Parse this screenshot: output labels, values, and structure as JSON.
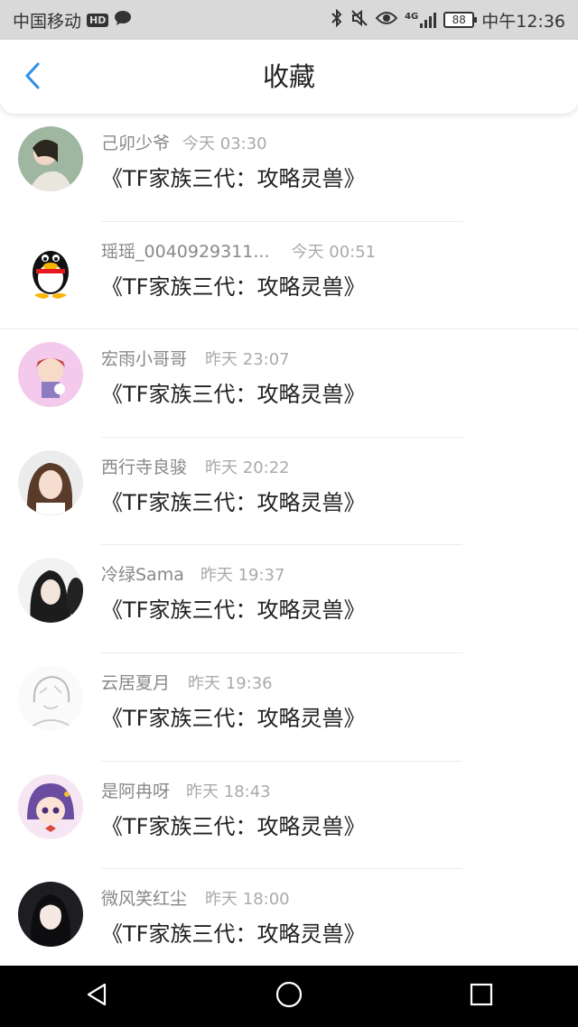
{
  "status_bar": {
    "carrier": "中国移动",
    "hd": "HD",
    "network": "4G",
    "battery": "88",
    "time": "中午12:36"
  },
  "header": {
    "title": "收藏"
  },
  "items": [
    {
      "user": "己卯少爷",
      "time": "今天 03:30",
      "title": "《TF家族三代：攻略灵兽》"
    },
    {
      "user": "瑶瑶_0040929311...",
      "time": "今天 00:51",
      "title": "《TF家族三代：攻略灵兽》"
    },
    {
      "user": "宏雨小哥哥",
      "time": "昨天 23:07",
      "title": "《TF家族三代：攻略灵兽》"
    },
    {
      "user": "西行寺良骏",
      "time": "昨天 20:22",
      "title": "《TF家族三代：攻略灵兽》"
    },
    {
      "user": "冷绿Sama",
      "time": "昨天 19:37",
      "title": "《TF家族三代：攻略灵兽》"
    },
    {
      "user": "云居夏月",
      "time": "昨天 19:36",
      "title": "《TF家族三代：攻略灵兽》"
    },
    {
      "user": "是阿冉呀",
      "time": "昨天 18:43",
      "title": "《TF家族三代：攻略灵兽》"
    },
    {
      "user": "微风笑红尘",
      "time": "昨天 18:00",
      "title": "《TF家族三代：攻略灵兽》"
    }
  ],
  "colors": {
    "accent": "#2c8fe8",
    "status_bar_bg": "#d9d9d9",
    "nav_bar_bg": "#000000"
  },
  "icons": [
    "chat-bubble-icon",
    "bluetooth-icon",
    "mute-icon",
    "eye-icon",
    "signal-icon",
    "battery-icon",
    "back-arrow-icon",
    "android-back-icon",
    "android-home-icon",
    "android-recents-icon"
  ]
}
